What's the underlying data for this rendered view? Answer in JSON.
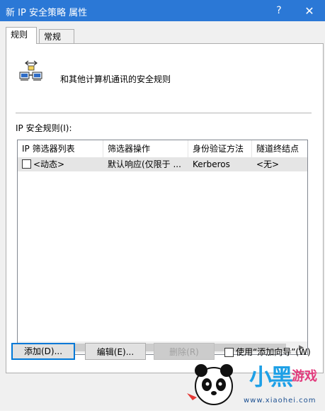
{
  "window": {
    "title": "新 IP 安全策略 属性",
    "help_glyph": "?",
    "close_glyph": "✕"
  },
  "tabs": [
    {
      "label": "规则",
      "active": true
    },
    {
      "label": "常规",
      "active": false
    }
  ],
  "panel": {
    "description": "和其他计算机通讯的安全规则",
    "list_label": "IP 安全规则(I):",
    "columns": [
      "IP 筛选器列表",
      "筛选器操作",
      "身份验证方法",
      "隧道终结点"
    ],
    "rows": [
      {
        "checked": false,
        "filter_list": "<动态>",
        "filter_action": "默认响应(仅限于 ...",
        "auth": "Kerberos",
        "tunnel": "<无>"
      }
    ]
  },
  "buttons": {
    "add": "添加(D)...",
    "edit": "编辑(E)...",
    "remove": "删除(R)",
    "wizard": "使用“添加向导”(W)"
  },
  "watermark": {
    "brand": "小黑",
    "game": "游戏",
    "url": "www.xiaohei.com"
  },
  "colors": {
    "titlebar": "#2b78d6",
    "focus_border": "#0078d7",
    "watermark_blue": "#1ea0e6"
  }
}
